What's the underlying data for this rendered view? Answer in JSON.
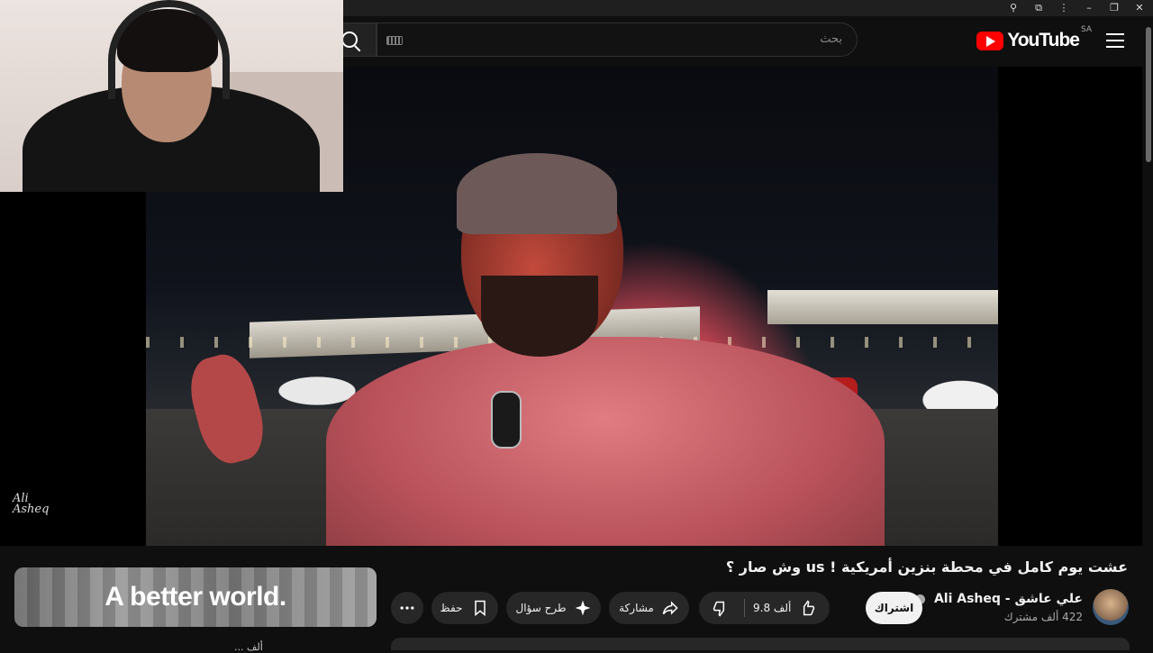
{
  "browser": {
    "controls": [
      "zoom-icon",
      "extensions-icon",
      "more-icon",
      "minimize-icon",
      "restore-icon",
      "close-icon"
    ]
  },
  "masthead": {
    "logo_text": "YouTube",
    "country_code": "SA",
    "search_placeholder": "بحث"
  },
  "video": {
    "title": "عشت يوم كامل في محطة بنزين أمريكية ! us وش صار ؟",
    "watermark_text": "Ali Asheq"
  },
  "channel": {
    "name": "علي عاشق - Ali Asheq",
    "subscribers": "422 ألف مشترك",
    "subscribe_label": "اشتراك"
  },
  "actions": {
    "likes": "9.8 ألف",
    "share_label": "مشاركة",
    "ask_label": "طرح سؤال",
    "save_label": "حفظ"
  },
  "ad": {
    "title": "A better world.",
    "cut_text": "... ألف"
  }
}
